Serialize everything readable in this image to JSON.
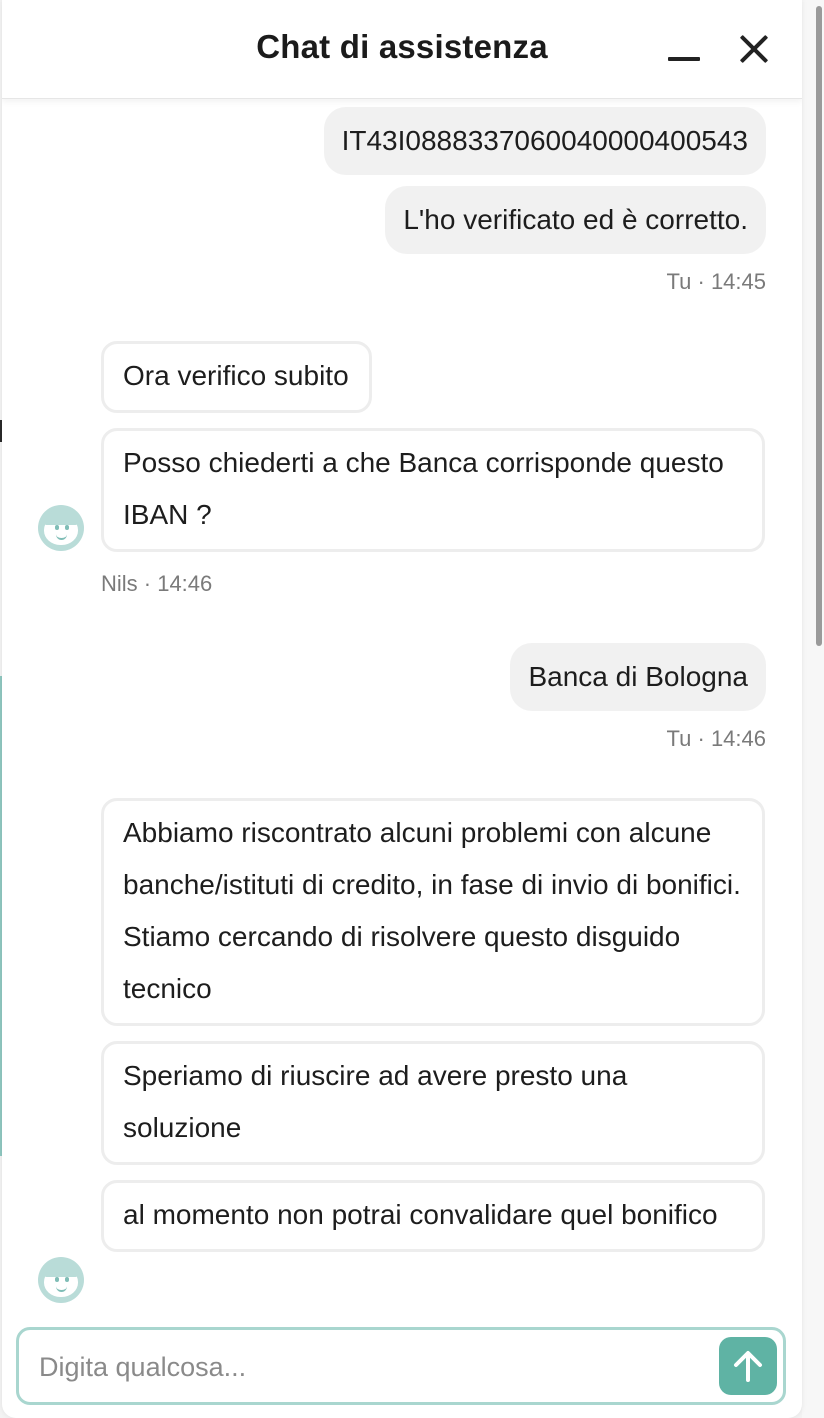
{
  "header": {
    "title": "Chat di assistenza"
  },
  "messages": [
    {
      "text": "IT43I0888337060040000400543"
    },
    {
      "text": "L'ho verificato ed è corretto."
    },
    {
      "meta": "Tu · 14:45"
    },
    {
      "text": "Ora verifico subito"
    },
    {
      "text": "Posso chiederti a che Banca corrisponde questo IBAN ?"
    },
    {
      "meta": "Nils · 14:46"
    },
    {
      "text": "Banca di Bologna"
    },
    {
      "meta": "Tu · 14:46"
    },
    {
      "text": "Abbiamo riscontrato alcuni problemi con alcune banche/istituti di credito, in fase di invio di bonifici. Stiamo cercando di risolvere questo disguido tecnico"
    },
    {
      "text": "Speriamo di riuscire ad avere presto una soluzione"
    },
    {
      "text": "al momento non potrai convalidare quel bonifico"
    }
  ],
  "composer": {
    "placeholder": "Digita qualcosa..."
  },
  "icons": {
    "minimize": "minimize-icon",
    "close": "close-icon",
    "send": "arrow-up-icon",
    "avatar": "agent-avatar-icon"
  },
  "colors": {
    "accent": "#5fb3a4",
    "accent_light": "#a9d6cf",
    "user_bubble": "#f1f1f1",
    "agent_border": "#ededed"
  }
}
